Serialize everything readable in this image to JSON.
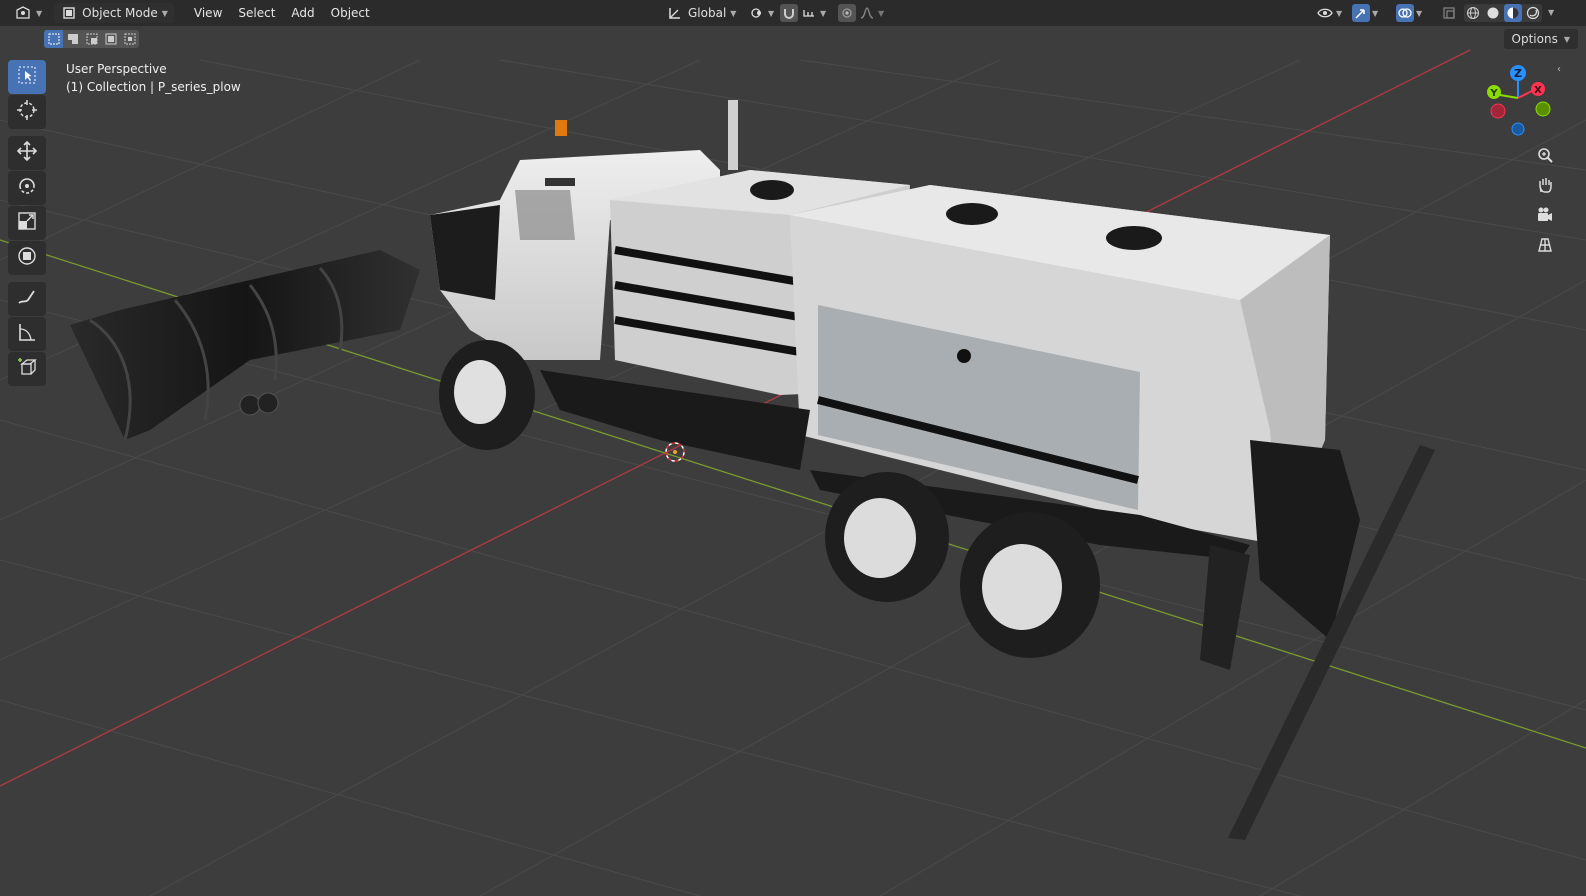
{
  "header": {
    "editor_type_icon": "3d-viewport-icon",
    "mode": {
      "label": "Object Mode",
      "icon": "object-mode-icon"
    },
    "menus": [
      "View",
      "Select",
      "Add",
      "Object"
    ],
    "orientation": {
      "label": "Global",
      "icon": "transform-orientation-icon"
    },
    "pivot_icon": "pivot-point-icon",
    "snap_icon": "snap-magnet-icon",
    "snap_target_icon": "snap-increment-icon",
    "proportional_icon": "proportional-editing-icon",
    "falloff_icon": "falloff-curve-icon",
    "visibility_icon": "eye-visibility-icon",
    "gizmo_icon": "gizmo-toggle-icon",
    "overlay_icon": "overlays-icon",
    "xray_icon": "xray-icon",
    "shading_modes": [
      "wireframe",
      "solid",
      "material-preview",
      "rendered"
    ],
    "active_shading": "material-preview"
  },
  "subheader": {
    "select_modes": [
      "set",
      "extend",
      "subtract",
      "invert",
      "intersect"
    ],
    "active_select_mode": "set",
    "options_label": "Options"
  },
  "viewport": {
    "perspective": "User Perspective",
    "collection": "(1) Collection | P_series_plow"
  },
  "toolbar": {
    "tools": [
      "select-box",
      "cursor",
      "move",
      "rotate",
      "scale",
      "transform",
      "annotate",
      "measure",
      "add-cube"
    ],
    "active_tool": "select-box"
  },
  "gizmo": {
    "axes": [
      "X",
      "Y",
      "Z"
    ],
    "colors": {
      "x": "#ff3352",
      "y": "#8bdc00",
      "z": "#2890ff"
    }
  },
  "nav": [
    "zoom-icon",
    "pan-hand-icon",
    "camera-icon",
    "ortho-grid-icon"
  ],
  "colors": {
    "accent": "#4772b3",
    "header_bg": "#2b2b2b",
    "viewport_bg": "#3d3d3d",
    "x_axis_line": "#b03a44",
    "y_axis_line": "#7a9a2f"
  }
}
